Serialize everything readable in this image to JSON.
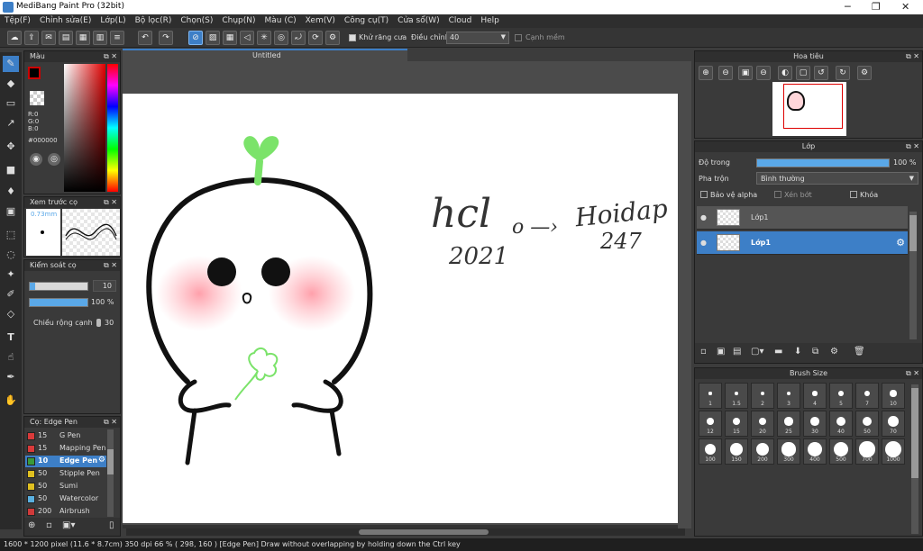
{
  "window": {
    "title": "MediBang Paint Pro (32bit)"
  },
  "menu": [
    "Tệp(F)",
    "Chỉnh sửa(E)",
    "Lớp(L)",
    "Bộ lọc(R)",
    "Chọn(S)",
    "Chụp(N)",
    "Màu (C)",
    "Xem(V)",
    "Công cụ(T)",
    "Cửa sổ(W)",
    "Cloud",
    "Help"
  ],
  "toolbar": {
    "antialias_label": "Khử răng cưa",
    "adjust_label": "Điều chỉnh",
    "adjust_value": "40",
    "soft_edge_label": "Cạnh mềm"
  },
  "document": {
    "tab_title": "Untitled"
  },
  "color_panel": {
    "title": "Màu",
    "r": "R:0",
    "g": "G:0",
    "b": "B:0",
    "hex": "#000000"
  },
  "preview_panel": {
    "title": "Xem trước cọ",
    "size": "0.73mm"
  },
  "brush_control": {
    "title": "Kiểm soát cọ",
    "size_value": "10",
    "size_fraction": 0.1,
    "opacity_value": "100 %",
    "opacity_fraction": 1.0,
    "edge_label": "Chiều rộng cạnh",
    "edge_value": "30"
  },
  "brush_list": {
    "title": "Cọ: Edge Pen",
    "items": [
      {
        "size": "15",
        "name": "G Pen",
        "color": "#d93a3a",
        "selected": false
      },
      {
        "size": "15",
        "name": "Mapping Pen",
        "color": "#d93a3a",
        "selected": false
      },
      {
        "size": "10",
        "name": "Edge Pen",
        "color": "#3a9a3a",
        "selected": true
      },
      {
        "size": "50",
        "name": "Stipple Pen",
        "color": "#e0c020",
        "selected": false
      },
      {
        "size": "50",
        "name": "Sumi",
        "color": "#e0c020",
        "selected": false
      },
      {
        "size": "50",
        "name": "Watercolor",
        "color": "#5ab0e0",
        "selected": false
      },
      {
        "size": "200",
        "name": "Airbrush",
        "color": "#d03a3a",
        "selected": false
      }
    ]
  },
  "navigator": {
    "title": "Hoa tiêu"
  },
  "layer_panel": {
    "title": "Lớp",
    "opacity_label": "Độ trong",
    "opacity_value": "100 %",
    "opacity_fraction": 1.0,
    "blend_label": "Pha trộn",
    "blend_value": "Bình thường",
    "protect_alpha": "Bảo vệ alpha",
    "clipping": "Xén bớt",
    "lock": "Khóa",
    "layers": [
      {
        "name": "Lớp1",
        "selected": false
      },
      {
        "name": "Lớp1",
        "selected": true
      }
    ]
  },
  "brush_size_panel": {
    "title": "Brush Size",
    "sizes": [
      "1",
      "1.5",
      "2",
      "3",
      "4",
      "5",
      "7",
      "10",
      "12",
      "15",
      "20",
      "25",
      "30",
      "40",
      "50",
      "70",
      "100",
      "150",
      "200",
      "300",
      "400",
      "500",
      "700",
      "1000"
    ]
  },
  "status": {
    "text": "1600 * 1200 pixel   (11.6 * 8.7cm)   350 dpi   66 %   ( 298, 160 )   [Edge Pen] Draw without overlapping by holding down the Ctrl key"
  },
  "canvas_text": {
    "line1": "hcl",
    "line2": "2021",
    "arrow": "o —›",
    "word1": "Hoidap",
    "word2": "247"
  },
  "colors": {
    "accent": "#3d7fc7",
    "primary": "#000000",
    "secondary": "#ffffff",
    "leaf": "#7be36a",
    "cheek": "#ffb0b8"
  }
}
